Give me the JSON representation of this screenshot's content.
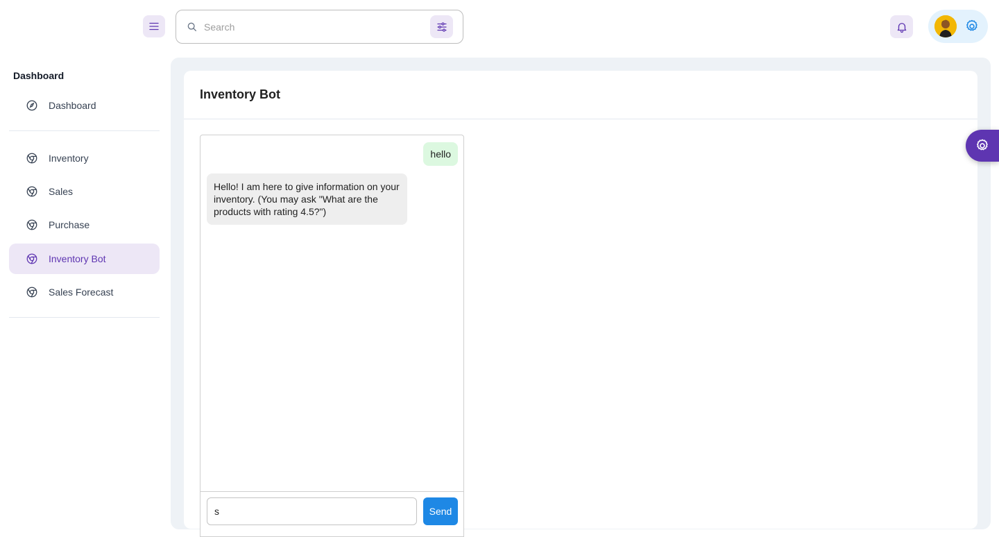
{
  "header": {
    "search_placeholder": "Search",
    "search_value": "",
    "icons": {
      "menu": "menu-icon",
      "search": "search-icon",
      "filter": "sliders-icon",
      "notifications": "bell-icon",
      "settings": "gear-icon"
    }
  },
  "sidebar": {
    "caption": "Dashboard",
    "items": [
      {
        "label": "Dashboard",
        "icon": "dashboard-icon",
        "active": false
      },
      {
        "label": "Inventory",
        "icon": "chrome-icon",
        "active": false
      },
      {
        "label": "Sales",
        "icon": "chrome-icon",
        "active": false
      },
      {
        "label": "Purchase",
        "icon": "chrome-icon",
        "active": false
      },
      {
        "label": "Inventory Bot",
        "icon": "chrome-icon",
        "active": true
      },
      {
        "label": "Sales Forecast",
        "icon": "chrome-icon",
        "active": false
      }
    ]
  },
  "main": {
    "title": "Inventory Bot",
    "chat": {
      "messages": [
        {
          "from": "user",
          "text": "hello"
        },
        {
          "from": "bot",
          "text": "Hello! I am here to give information on your inventory. (You may ask \"What are the products with rating 4.5?\")"
        }
      ],
      "input_value": "s",
      "send_label": "Send"
    }
  },
  "colors": {
    "accent": "#5e35b1",
    "accent_light": "#ede7f6",
    "send_button": "#1e88e5",
    "user_bubble": "#dcf8e0",
    "bot_bubble": "#eeeeee",
    "page_bg": "#eef2f6"
  }
}
